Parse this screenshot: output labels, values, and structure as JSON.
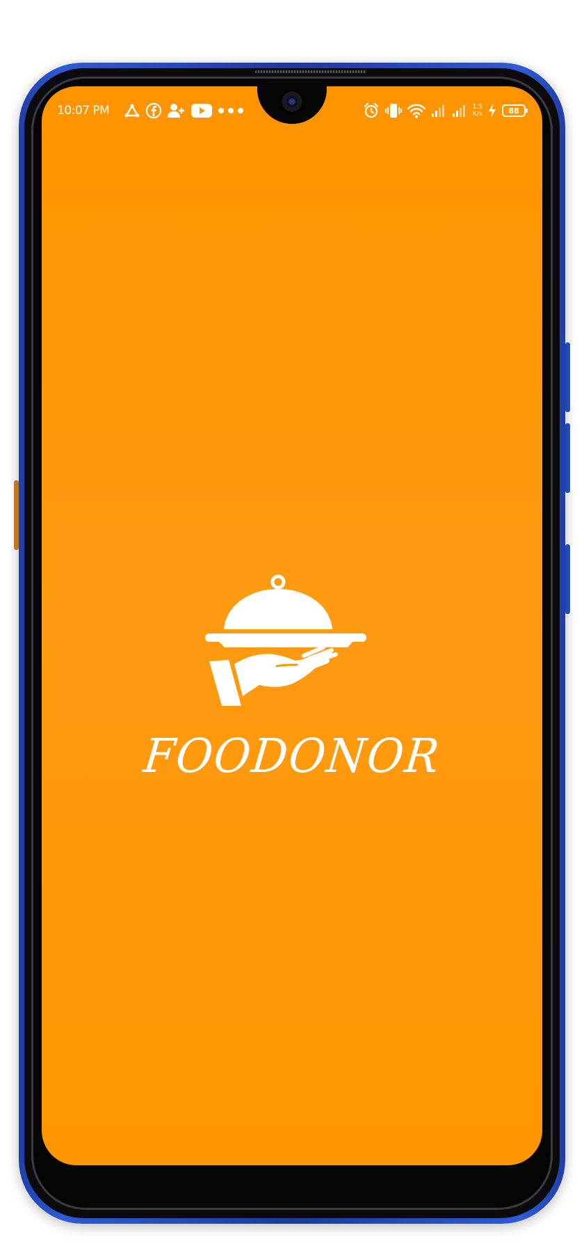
{
  "status_bar": {
    "time": "10:07 PM",
    "left_icons": [
      "triangle-share-icon",
      "facebook-icon",
      "add-contact-icon",
      "youtube-icon",
      "more-dots-icon"
    ],
    "right_icons": [
      "alarm-icon",
      "vibrate-icon",
      "wifi-icon",
      "signal-icon",
      "signal-icon"
    ],
    "net_speed_value": "1.5",
    "net_speed_unit": "K/s",
    "battery_level": "88",
    "charging": true
  },
  "splash": {
    "logo_icon": "food-serving-hand-icon",
    "app_name": "FOODONOR"
  },
  "colors": {
    "background": "#FF9500",
    "foreground": "#FFFFFF",
    "phone_frame": "#2748B8"
  }
}
